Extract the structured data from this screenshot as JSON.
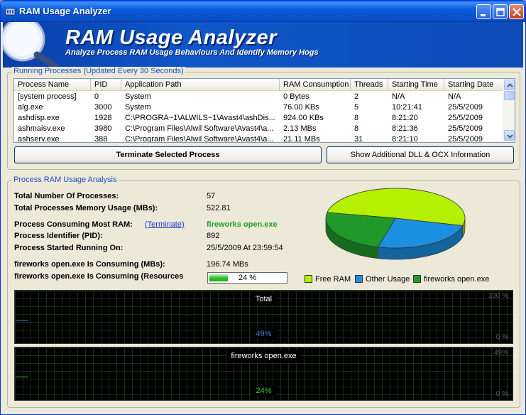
{
  "window": {
    "title": "RAM Usage Analyzer",
    "minimize_label": "minimize",
    "maximize_label": "maximize",
    "close_label": "close"
  },
  "banner": {
    "title": "RAM Usage Analyzer",
    "subtitle": "Analyze Process RAM Usage Behaviours And Identify Memory Hogs"
  },
  "processes": {
    "group_label": "Running Processes (Updated Every 30 Seconds)",
    "columns": [
      "Process Name",
      "PID",
      "Application Path",
      "RAM Consumption",
      "Threads",
      "Starting Time",
      "Starting Date"
    ],
    "rows": [
      [
        "[system process]",
        "0",
        "System",
        "0 Bytes",
        "2",
        "N/A",
        "N/A"
      ],
      [
        "alg.exe",
        "3000",
        "System",
        "76.00 KBs",
        "5",
        "10:21:41",
        "25/5/2009"
      ],
      [
        "ashdisp.exe",
        "1928",
        "C:\\PROGRA~1\\ALWILS~1\\Avast4\\ashDis...",
        "924.00 KBs",
        "8",
        "8:21:20",
        "25/5/2009"
      ],
      [
        "ashmaisv.exe",
        "3980",
        "C:\\Program Files\\Alwil Software\\Avast4\\a...",
        "2.13 MBs",
        "8",
        "8:21:36",
        "25/5/2009"
      ],
      [
        "ashserv.exe",
        "388",
        "C:\\Program Files\\Alwil Software\\Avast4\\a...",
        "21.11 MBs",
        "31",
        "8:21:10",
        "25/5/2009"
      ]
    ],
    "terminate_button": "Terminate Selected Process",
    "dll_button": "Show Additional DLL & OCX Information"
  },
  "analysis": {
    "group_label": "Process RAM Usage Analysis",
    "total_processes_label": "Total Number Of Processes:",
    "total_processes_value": "57",
    "total_memory_label": "Total Processes Memory Usage (MBs):",
    "total_memory_value": "522.81",
    "most_ram_label": "Process Consuming Most RAM:",
    "terminate_link": "(Terminate)",
    "most_ram_value": "fireworks open.exe",
    "pid_label": "Process Identifier (PID):",
    "pid_value": "892",
    "started_label": "Process Started Running On:",
    "started_value": "25/5/2009 At 23:59:54",
    "consuming_mb_label": "fireworks open.exe Is Consuming (MBs):",
    "consuming_mb_value": "196.74 MBs",
    "consuming_res_label": "fireworks open.exe Is Consuming (Resources",
    "consuming_res_value": "24 %",
    "consuming_res_fraction": 0.24
  },
  "chart_data": {
    "type": "pie",
    "categories": [
      "Free RAM",
      "Other Usage",
      "fireworks open.exe"
    ],
    "values": [
      51,
      25,
      24
    ],
    "colors": [
      "#b4f000",
      "#1d8fe0",
      "#1f9a2a"
    ],
    "legend_placement": "bottom"
  },
  "legend": [
    {
      "label": "Free RAM",
      "color": "#b4f000"
    },
    {
      "label": "Other Usage",
      "color": "#1d8fe0"
    },
    {
      "label": "fireworks open.exe",
      "color": "#1f9a2a"
    }
  ],
  "graphs": [
    {
      "title": "Total",
      "current": "49%",
      "axis_top": "100 %",
      "axis_bottom": "0 %",
      "color": "#3a7bd5"
    },
    {
      "title": "fireworks open.exe",
      "current": "24%",
      "axis_top": "49%",
      "axis_bottom": "0 %",
      "color": "#2ecc2e"
    }
  ]
}
